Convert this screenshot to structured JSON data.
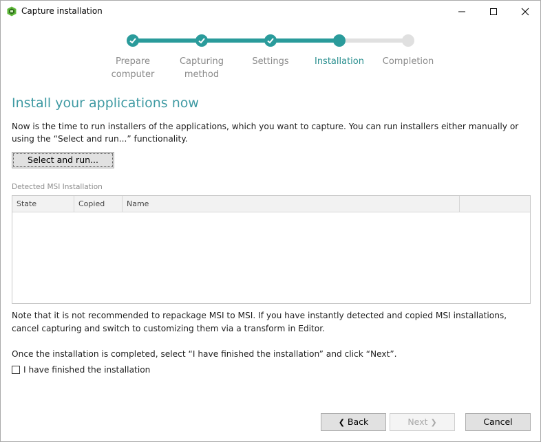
{
  "window": {
    "title": "Capture installation"
  },
  "icons": {
    "app": "app-logo-icon",
    "minimize": "minimize-icon",
    "maximize": "maximize-icon",
    "close": "close-icon",
    "check": "check-icon",
    "back": "chevron-left-icon",
    "next": "chevron-right-icon"
  },
  "colors": {
    "accent": "#2a9b9b",
    "heading": "#3f9aa3",
    "inactive": "#e0e0e0"
  },
  "stepper": {
    "current_index": 3,
    "steps": [
      {
        "label_line1": "Prepare",
        "label_line2": "computer",
        "state": "done"
      },
      {
        "label_line1": "Capturing",
        "label_line2": "method",
        "state": "done"
      },
      {
        "label_line1": "Settings",
        "label_line2": "",
        "state": "done"
      },
      {
        "label_line1": "Installation",
        "label_line2": "",
        "state": "active"
      },
      {
        "label_line1": "Completion",
        "label_line2": "",
        "state": "pending"
      }
    ]
  },
  "content": {
    "heading": "Install your applications now",
    "intro": "Now is the time to run installers of the applications, which you want to capture. You can run installers either manually or using the “Select and run...” functionality.",
    "select_run_label": "Select and run...",
    "section_label": "Detected MSI Installation",
    "table": {
      "columns": [
        "State",
        "Copied",
        "Name",
        ""
      ],
      "rows": []
    },
    "note": "Note that it is not recommended to repackage MSI to MSI. If you have instantly detected and copied MSI installations, cancel capturing and switch to customizing them via a transform in Editor.",
    "once_text": "Once the installation is completed, select “I have finished the installation” and click “Next”.",
    "checkbox_label": "I have finished the installation",
    "checkbox_checked": false
  },
  "footer": {
    "back_label": "Back",
    "next_label": "Next",
    "cancel_label": "Cancel",
    "next_enabled": false
  }
}
